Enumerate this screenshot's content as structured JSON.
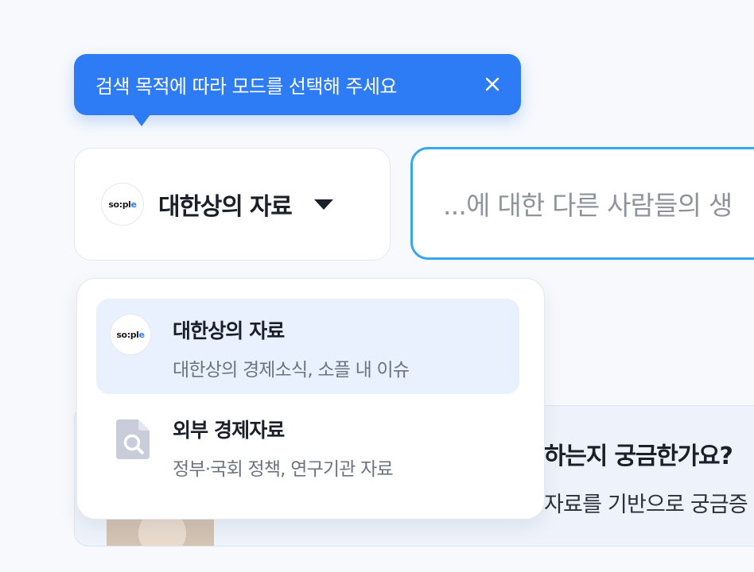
{
  "tooltip": {
    "text": "검색 목적에 따라 모드를 선택해 주세요",
    "close_icon": "close-icon",
    "color": "#2e7bf6"
  },
  "mode_selector": {
    "logo_text_main": "so:pl",
    "logo_text_accent": "e",
    "selected_label": "대한상의 자료",
    "dropdown_icon": "caret-down-icon"
  },
  "search": {
    "placeholder": "...에 대한 다른 사람들의 생",
    "border_color": "#38a6ee"
  },
  "dropdown": {
    "items": [
      {
        "title": "대한상의 자료",
        "description": "대한상의 경제소식, 소플 내 이슈",
        "icon": "sople-logo-icon",
        "selected": true
      },
      {
        "title": "외부 경제자료",
        "description": "정부·국회 정책, 연구기관 자료",
        "icon": "document-search-icon",
        "selected": false
      }
    ]
  },
  "background_card": {
    "title": "하는지 궁금한가요?",
    "description": "자료를 기반으로 궁금증"
  }
}
